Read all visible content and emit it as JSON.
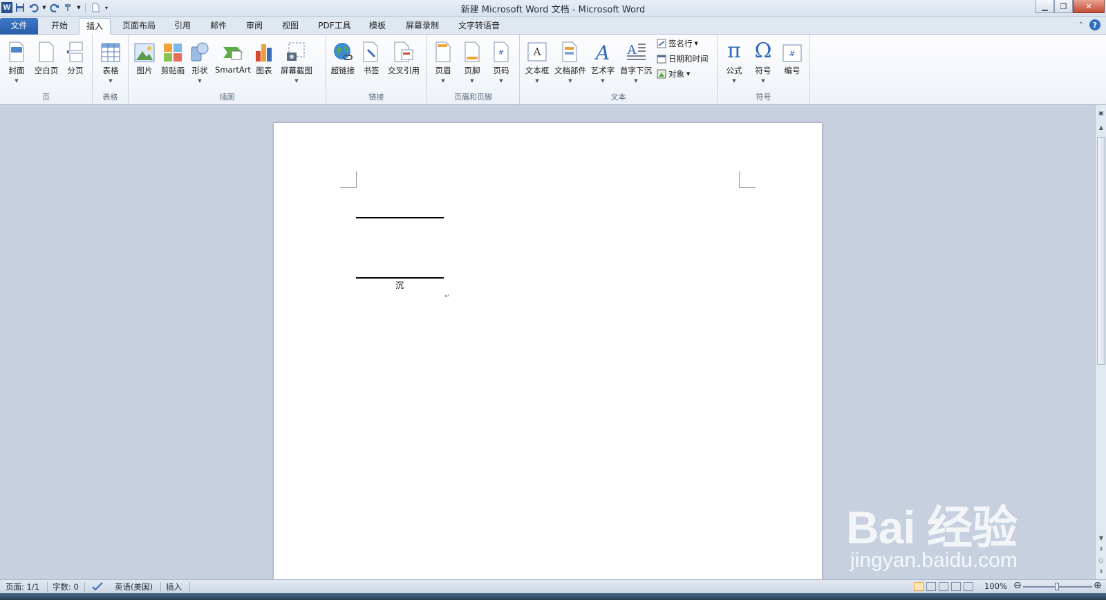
{
  "window": {
    "title": "新建 Microsoft Word 文档 - Microsoft Word",
    "app_icon": "W"
  },
  "tabs": [
    {
      "label": "文件"
    },
    {
      "label": "开始"
    },
    {
      "label": "插入"
    },
    {
      "label": "页面布局"
    },
    {
      "label": "引用"
    },
    {
      "label": "邮件"
    },
    {
      "label": "审阅"
    },
    {
      "label": "视图"
    },
    {
      "label": "PDF工具"
    },
    {
      "label": "模板"
    },
    {
      "label": "屏幕录制"
    },
    {
      "label": "文字转语音"
    }
  ],
  "ribbon": {
    "groups": {
      "page": {
        "label": "页",
        "buttons": [
          "封面",
          "空白页",
          "分页"
        ]
      },
      "table": {
        "label": "表格",
        "buttons": [
          "表格"
        ]
      },
      "illustrations": {
        "label": "插图",
        "buttons": [
          "图片",
          "剪贴画",
          "形状",
          "SmartArt",
          "图表",
          "屏幕截图"
        ]
      },
      "links": {
        "label": "链接",
        "buttons": [
          "超链接",
          "书签",
          "交叉引用"
        ]
      },
      "header_footer": {
        "label": "页眉和页脚",
        "buttons": [
          "页眉",
          "页脚",
          "页码"
        ]
      },
      "text": {
        "label": "文本",
        "buttons": [
          "文本框",
          "文档部件",
          "艺术字",
          "首字下沉"
        ],
        "small": [
          "签名行",
          "日期和时间",
          "对象"
        ]
      },
      "symbols": {
        "label": "符号",
        "buttons": [
          "公式",
          "符号",
          "编号"
        ]
      }
    }
  },
  "document": {
    "character": "沉"
  },
  "status": {
    "page": "页面: 1/1",
    "words": "字数: 0",
    "language": "英语(美国)",
    "mode": "插入",
    "zoom": "100%"
  },
  "watermark": {
    "main": "Bai 经验",
    "sub": "jingyan.baidu.com"
  },
  "colors": {
    "file_tab": "#2a5ca8",
    "ribbon_bg": "#f3f6fb",
    "doc_bg": "#c6d0de"
  }
}
